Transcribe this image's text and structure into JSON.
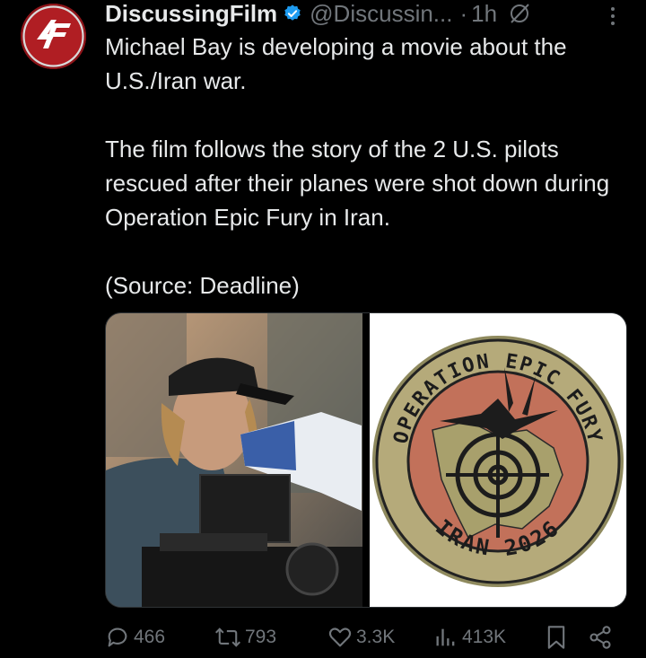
{
  "tweet": {
    "author": {
      "name": "DiscussingFilm",
      "handle": "@Discussin...",
      "verified": true,
      "avatar_icon": "discussingfilm-logo"
    },
    "separator": "·",
    "time": "1h",
    "paragraphs": [
      "Michael Bay is developing a movie about the U.S./Iran war.",
      "The film follows the story of the 2 U.S. pilots rescued after their planes were shot down during Operation Epic Fury in Iran.",
      "(Source: Deadline)"
    ],
    "media": {
      "patch": {
        "top_text": "OPERATION EPIC FURY",
        "bottom_text": "IRAN 2026"
      }
    },
    "actions": {
      "replies": "466",
      "reposts": "793",
      "likes": "3.3K",
      "views": "413K"
    }
  },
  "colors": {
    "background": "#000000",
    "text": "#e7e9ea",
    "muted": "#71767b",
    "verified": "#1d9bf0",
    "avatar": "#b01e23"
  }
}
